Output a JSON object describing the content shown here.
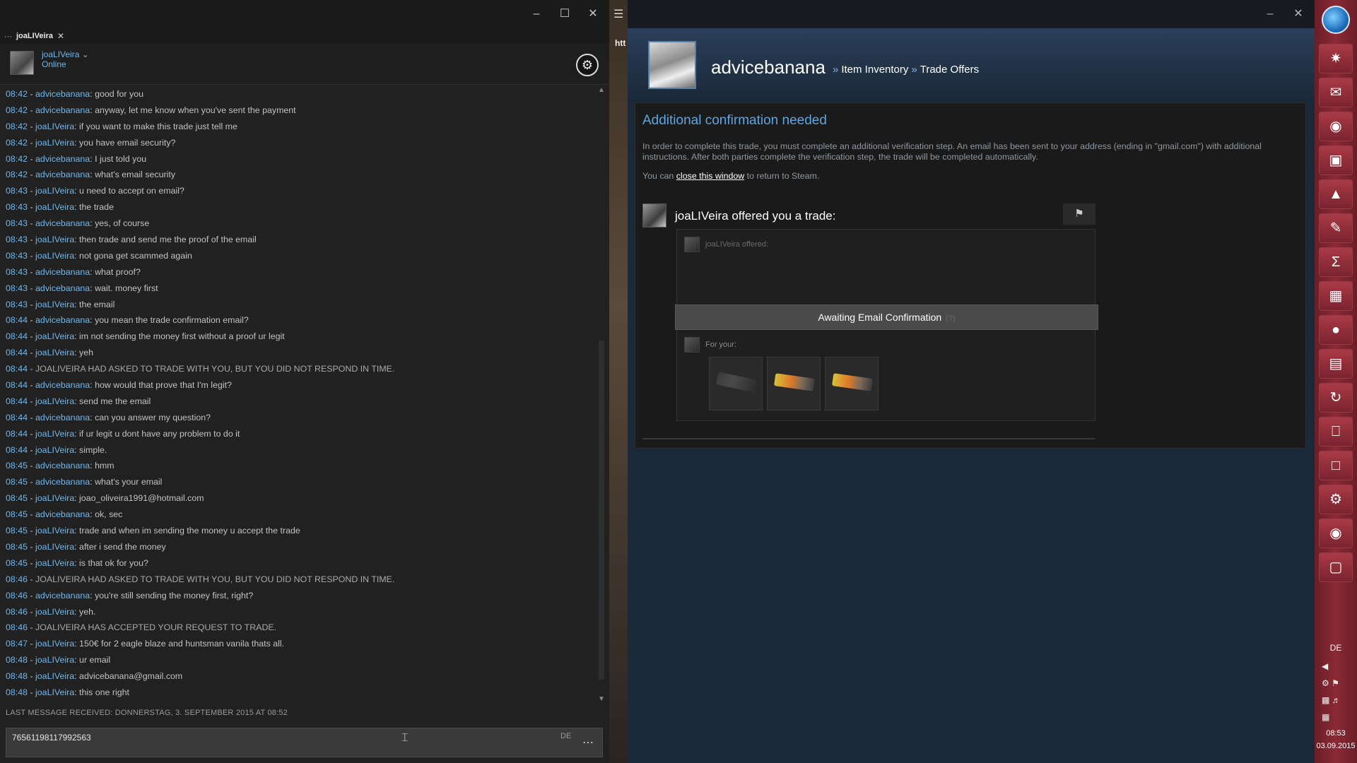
{
  "chat": {
    "tab_label": "joaLIVeira",
    "user": {
      "name": "joaLIVeira",
      "status": "Online"
    },
    "messages": [
      {
        "ts": "08:42",
        "sender": "advicebanana",
        "text": "good for you"
      },
      {
        "ts": "08:42",
        "sender": "advicebanana",
        "text": "anyway, let me know when you've sent the payment"
      },
      {
        "ts": "08:42",
        "sender": "joaLIVeira",
        "text": "if you want to make this trade just tell me"
      },
      {
        "ts": "08:42",
        "sender": "joaLIVeira",
        "text": "you have email security?"
      },
      {
        "ts": "08:42",
        "sender": "advicebanana",
        "text": "I just told you"
      },
      {
        "ts": "08:42",
        "sender": "advicebanana",
        "text": "what's email security"
      },
      {
        "ts": "08:43",
        "sender": "joaLIVeira",
        "text": "u need to accept on email?"
      },
      {
        "ts": "08:43",
        "sender": "joaLIVeira",
        "text": "the trade"
      },
      {
        "ts": "08:43",
        "sender": "advicebanana",
        "text": "yes, of course"
      },
      {
        "ts": "08:43",
        "sender": "joaLIVeira",
        "text": "then trade and send me the proof of the email"
      },
      {
        "ts": "08:43",
        "sender": "joaLIVeira",
        "text": "not gona get scammed again"
      },
      {
        "ts": "08:43",
        "sender": "advicebanana",
        "text": "what proof?"
      },
      {
        "ts": "08:43",
        "sender": "advicebanana",
        "text": "wait. money first"
      },
      {
        "ts": "08:43",
        "sender": "joaLIVeira",
        "text": "the email"
      },
      {
        "ts": "08:44",
        "sender": "advicebanana",
        "text": "you mean the trade confirmation email?"
      },
      {
        "ts": "08:44",
        "sender": "joaLIVeira",
        "text": "im not sending the money first without a proof ur legit"
      },
      {
        "ts": "08:44",
        "sender": "joaLIVeira",
        "text": "yeh"
      },
      {
        "ts": "08:44",
        "system": "JOALIVEIRA HAD ASKED TO TRADE WITH YOU, BUT YOU DID NOT RESPOND IN TIME."
      },
      {
        "ts": "08:44",
        "sender": "advicebanana",
        "text": "how would that prove that I'm legit?"
      },
      {
        "ts": "08:44",
        "sender": "joaLIVeira",
        "text": "send me the email"
      },
      {
        "ts": "08:44",
        "sender": "advicebanana",
        "text": "can you answer my question?"
      },
      {
        "ts": "08:44",
        "sender": "joaLIVeira",
        "text": "if ur legit u dont have any problem to do it"
      },
      {
        "ts": "08:44",
        "sender": "joaLIVeira",
        "text": "simple."
      },
      {
        "ts": "08:45",
        "sender": "advicebanana",
        "text": "hmm"
      },
      {
        "ts": "08:45",
        "sender": "advicebanana",
        "text": "what's your email"
      },
      {
        "ts": "08:45",
        "sender": "joaLIVeira",
        "text": "joao_oliveira1991@hotmail.com"
      },
      {
        "ts": "08:45",
        "sender": "advicebanana",
        "text": "ok, sec"
      },
      {
        "ts": "08:45",
        "sender": "joaLIVeira",
        "text": "trade and when im sending the money u accept the trade"
      },
      {
        "ts": "08:45",
        "sender": "joaLIVeira",
        "text": "after i send the money"
      },
      {
        "ts": "08:45",
        "sender": "joaLIVeira",
        "text": "is that ok for you?"
      },
      {
        "ts": "08:46",
        "system": "JOALIVEIRA HAD ASKED TO TRADE WITH YOU, BUT YOU DID NOT RESPOND IN TIME."
      },
      {
        "ts": "08:46",
        "sender": "advicebanana",
        "text": "you're still sending the money first, right?"
      },
      {
        "ts": "08:46",
        "sender": "joaLIVeira",
        "text": "yeh."
      },
      {
        "ts": "08:46",
        "system": "JOALIVEIRA HAS ACCEPTED YOUR REQUEST TO TRADE."
      },
      {
        "ts": "08:47",
        "sender": "joaLIVeira",
        "text": "150€ for 2 eagle blaze and huntsman vanila thats all."
      },
      {
        "ts": "08:48",
        "sender": "joaLIVeira",
        "text": "ur email"
      },
      {
        "ts": "08:48",
        "sender": "joaLIVeira",
        "text": "advicebanana@gmail.com"
      },
      {
        "ts": "08:48",
        "sender": "joaLIVeira",
        "text": "this one right"
      }
    ],
    "last_message": "LAST MESSAGE RECEIVED: DONNERSTAG, 3. SEPTEMBER 2015 AT 08:52",
    "input_value": "76561198117992563",
    "input_lang": "DE"
  },
  "steam": {
    "address_fragment": "htt",
    "profile_name": "advicebanana",
    "crumbs": [
      "Item Inventory",
      "Trade Offers"
    ],
    "confirm_title": "Additional confirmation needed",
    "confirm_body": "In order to complete this trade, you must complete an additional verification step. An email has been sent to your address (ending in \"gmail.com\") with additional instructions. After both parties complete the verification step, the trade will be completed automatically.",
    "return_prefix": "You can",
    "return_link": "close this window",
    "return_suffix": "to return to Steam.",
    "offer_title": "joaLIVeira offered you a trade:",
    "offered_label": "joaLIVeira offered:",
    "awaiting_label": "Awaiting Email Confirmation",
    "awaiting_help": "(?)",
    "for_your_label": "For your:",
    "items": [
      "knife",
      "blaze",
      "blaze"
    ]
  },
  "taskbar": {
    "lang": "DE",
    "time": "08:53",
    "date": "03.09.2015"
  }
}
